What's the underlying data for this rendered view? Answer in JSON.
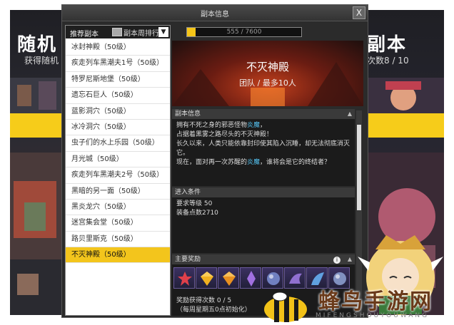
{
  "background": {
    "left_title": "随机",
    "left_subtitle": "获得随机",
    "right_title": "副本",
    "right_subtitle": "次数8 / 10"
  },
  "dialog": {
    "title": "副本信息",
    "close_label": "X"
  },
  "dungeon_list": {
    "dropdown_label": "推荐副本",
    "items": [
      {
        "label": "冰封神殿（50级）"
      },
      {
        "label": "疾走列车黑潮夫1号（50级）"
      },
      {
        "label": "特罗尼斯地堡（50级）"
      },
      {
        "label": "遗忘石巨人（50级）"
      },
      {
        "label": "蓝影洞穴（50级）"
      },
      {
        "label": "冰冷洞穴（50级）"
      },
      {
        "label": "虫子们的水上乐园（50级）"
      },
      {
        "label": "月光城（50级）"
      },
      {
        "label": "疾走列车黑潮夫2号（50级）"
      },
      {
        "label": "黑暗的另一面（50级）"
      },
      {
        "label": "黑炎龙穴（50级）"
      },
      {
        "label": "迷宫集会堂（50级）"
      },
      {
        "label": "路贝里斯克（50级）"
      },
      {
        "label": "不灭神殿（50级）"
      }
    ],
    "selected_index": 13
  },
  "ranking": {
    "label": "副本周排行",
    "progress_text": "555 / 7600",
    "progress_fraction": 0.073
  },
  "banner": {
    "name": "不灭神殿",
    "party": "团队 / 最多10人"
  },
  "info_section": {
    "title": "副本信息",
    "line1_pre": "拥有不死之身的邪恶怪物",
    "line1_hl": "炎魔",
    "line1_post": "，",
    "line2": "占据着黑雾之路尽头的不灭神殿！",
    "line3": "长久以来，人类只能依靠封印使其陷入沉睡，却无法彻底消灭它。",
    "line4_pre": "现在，面对再一次苏醒的",
    "line4_hl": "炎魔",
    "line4_post": "，谁将会是它的终结者？"
  },
  "requirements": {
    "title": "进入条件",
    "level": "要求等级 50",
    "gear": "装备点数2710"
  },
  "rewards": {
    "title": "主要奖励",
    "count": "奖励获得次数 0 / 5",
    "reset": "（每周星期五0点初始化）",
    "items": [
      {
        "icon": "star-icon",
        "color": "#e0404a"
      },
      {
        "icon": "gem-icon",
        "color": "#f0b020"
      },
      {
        "icon": "gem-icon",
        "color": "#e89020"
      },
      {
        "icon": "crystal-icon",
        "color": "#a070e0"
      },
      {
        "icon": "orb-icon",
        "color": "#7080c0"
      },
      {
        "icon": "dragon-icon",
        "color": "#9070d0"
      },
      {
        "icon": "wing-icon",
        "color": "#60a0e0"
      },
      {
        "icon": "orb-icon",
        "color": "#8090c0"
      }
    ]
  },
  "watermark": {
    "text": "蜂鸟手游网",
    "sub": "MIFENGSHOUYOUWANG"
  }
}
